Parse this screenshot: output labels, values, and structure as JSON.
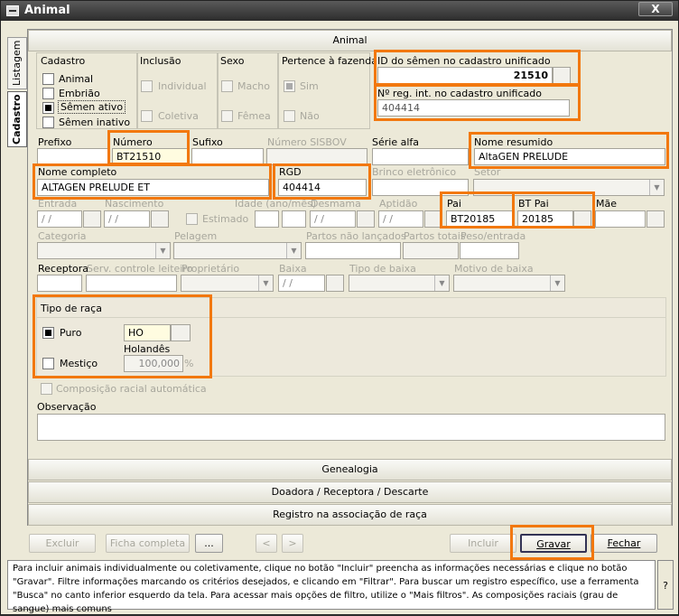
{
  "window": {
    "title": "Animal",
    "close": "X"
  },
  "side_tabs": {
    "listagem": "Listagem",
    "cadastro": "Cadastro"
  },
  "header": "Animal",
  "cadastro": {
    "label": "Cadastro",
    "options": [
      "Animal",
      "Embrião",
      "Sêmen ativo",
      "Sêmen inativo"
    ],
    "selected": "Sêmen ativo"
  },
  "inclusao": {
    "label": "Inclusão",
    "options": [
      "Individual",
      "Coletiva"
    ]
  },
  "sexo": {
    "label": "Sexo",
    "options": [
      "Macho",
      "Fêmea"
    ]
  },
  "fazenda": {
    "label": "Pertence à fazenda",
    "options": [
      "Sim",
      "Não"
    ]
  },
  "id_semen": {
    "label": "ID do sêmen no cadastro unificado",
    "value": "21510"
  },
  "nreg": {
    "label": "Nº reg. int. no cadastro unificado",
    "value": "404414"
  },
  "row1": {
    "prefixo": "Prefixo",
    "numero": "Número",
    "numero_value": "BT21510",
    "sufixo": "Sufixo",
    "sisbov": "Número SISBOV",
    "serie": "Série alfa",
    "nome_resumido": "Nome resumido",
    "nome_resumido_value": "AltaGEN PRELUDE"
  },
  "row2": {
    "nome_completo": "Nome completo",
    "nome_completo_value": "ALTAGEN PRELUDE ET",
    "rgd": "RGD",
    "rgd_value": "404414",
    "brinco": "Brinco eletrônico",
    "setor": "Setor"
  },
  "row3": {
    "entrada": "Entrada",
    "nascimento": "Nascimento",
    "idade": "Idade (ano/mês)",
    "desmama": "Desmama",
    "aptidao": "Aptidão",
    "estimado": "Estimado",
    "date_placeholder": "/ /",
    "pai": "Pai",
    "pai_value": "BT20185",
    "bt_pai": "BT Pai",
    "bt_pai_value": "20185",
    "mae": "Mãe"
  },
  "row4": {
    "categoria": "Categoria",
    "pelagem": "Pelagem",
    "partos_nao": "Partos não lançados",
    "partos_totais": "Partos totais",
    "peso": "Peso/entrada"
  },
  "row5": {
    "receptora": "Receptora",
    "serv": "Serv. controle leiteiro",
    "proprietario": "Proprietário",
    "baixa": "Baixa",
    "baixa_value": "/ /",
    "tipo_baixa": "Tipo de baixa",
    "motivo": "Motivo de baixa"
  },
  "raca": {
    "label": "Tipo de raça",
    "puro": "Puro",
    "puro_value": "HO",
    "mestico": "Mestiço",
    "holandes": "Holandês",
    "pct": "100,000",
    "pct_unit": "%"
  },
  "composicao": "Composição racial automática",
  "observacao": "Observação",
  "sections": [
    "Genealogia",
    "Doadora / Receptora / Descarte",
    "Registro na associação de raça"
  ],
  "buttons": {
    "excluir": "Excluir",
    "ficha": "Ficha completa",
    "more": "...",
    "prev": "<",
    "next": ">",
    "incluir": "Incluir",
    "gravar": "Gravar",
    "fechar": "Fechar"
  },
  "help": "Para incluir animais individualmente ou coletivamente, clique no botão \"Incluir\" preencha as informações necessárias e clique no botão \"Gravar\". Filtre informações marcando os critérios desejados, e clicando em \"Filtrar\". Para buscar um registro específico, use a ferramenta \"Busca\" no canto inferior esquerdo da tela. Para acessar mais opções de filtro, utilize o \"Mais filtros\". As composições raciais (grau de sangue) mais comuns",
  "help_q": "?",
  "highlight_color": "#f2780f"
}
